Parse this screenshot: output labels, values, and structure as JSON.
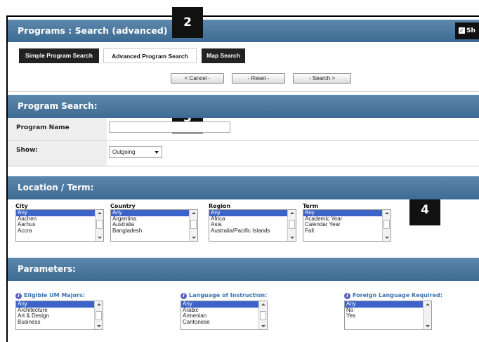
{
  "window": {
    "title": "Programs : Search (advanced)",
    "show_toggle_label": "Sh"
  },
  "callouts": [
    "2",
    "3",
    "4"
  ],
  "tabs": [
    {
      "label": "Simple Program Search",
      "active": false
    },
    {
      "label": "Advanced Program Search",
      "active": true
    },
    {
      "label": "Map Search",
      "active": false
    }
  ],
  "actions": {
    "cancel": "< Cancel -",
    "reset": "- Reset -",
    "search": "- Search >"
  },
  "program_search": {
    "heading": "Program Search:",
    "program_name_label": "Program Name",
    "program_name_value": "",
    "show_label": "Show:",
    "show_value": "Outgoing"
  },
  "location_term": {
    "heading": "Location / Term:",
    "city": {
      "label": "City",
      "options": [
        "Any",
        "Aachen",
        "Aarhus",
        "Accra"
      ],
      "selected": "Any"
    },
    "country": {
      "label": "Country",
      "options": [
        "Any",
        "Argentina",
        "Australia",
        "Bangladesh"
      ],
      "selected": "Any"
    },
    "region": {
      "label": "Region",
      "options": [
        "Any",
        "Africa",
        "Asia",
        "Australia/Pacific Islands"
      ],
      "selected": "Any"
    },
    "term": {
      "label": "Term",
      "options": [
        "Any",
        "Academic Year",
        "Calendar Year",
        "Fall"
      ],
      "selected": "Any"
    }
  },
  "parameters": {
    "heading": "Parameters:",
    "majors": {
      "label": "Eligible UM Majors:",
      "options": [
        "Any",
        "Architecture",
        "Art & Design",
        "Business"
      ],
      "selected": "Any"
    },
    "language": {
      "label": "Language of Instruction:",
      "options": [
        "Any",
        "Arabic",
        "Armenian",
        "Cantonese"
      ],
      "selected": "Any"
    },
    "foreign_language": {
      "label": "Foreign Language Required:",
      "options": [
        "Any",
        "No",
        "Yes"
      ],
      "selected": "Any"
    }
  },
  "colors": {
    "header_bar": "#4a7aa3",
    "selection": "#3c64c8",
    "param_label": "#3a72b0",
    "callout": "#111111"
  }
}
